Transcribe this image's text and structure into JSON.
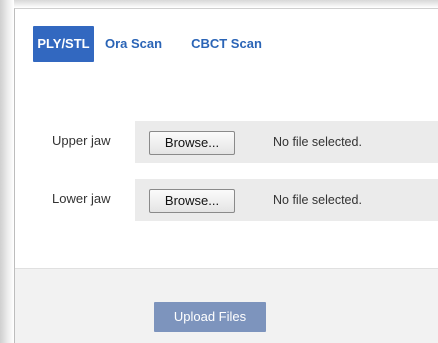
{
  "tabs": [
    {
      "label": "PLY/STL",
      "active": true
    },
    {
      "label": "Ora Scan",
      "active": false
    },
    {
      "label": "CBCT Scan",
      "active": false
    }
  ],
  "rows": [
    {
      "label": "Upper jaw",
      "browse_label": "Browse...",
      "status": "No file selected."
    },
    {
      "label": "Lower jaw",
      "browse_label": "Browse...",
      "status": "No file selected."
    }
  ],
  "footer": {
    "upload_label": "Upload Files"
  },
  "colors": {
    "accent": "#3268c0",
    "tab_link": "#2a64b6",
    "upload_button": "#7d94bd",
    "row_bg": "#ebebeb",
    "footer_bg": "#f2f2f2"
  }
}
